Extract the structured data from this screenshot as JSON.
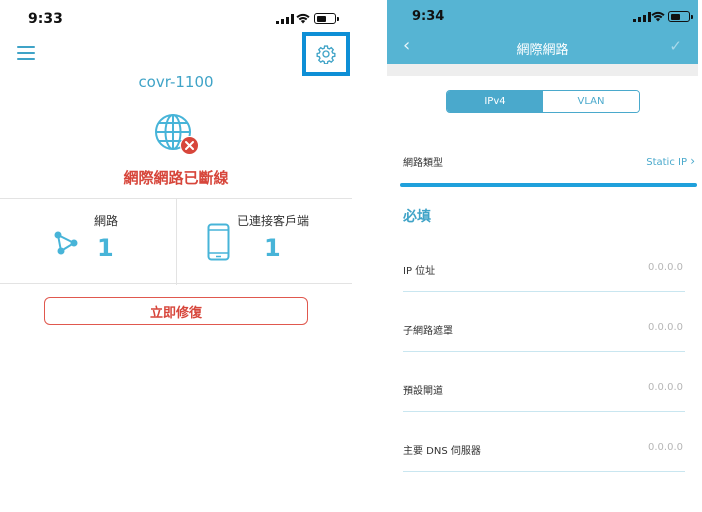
{
  "left": {
    "status_bar": {
      "time": "9:33"
    },
    "device_name": "covr-1100",
    "internet_status": "網際網路已斷線",
    "stats": {
      "network": {
        "label": "網路",
        "value": "1"
      },
      "clients": {
        "label": "已連接客戶端",
        "value": "1"
      }
    },
    "repair_button": "立即修復",
    "colors": {
      "accent": "#47b4d8",
      "error": "#d7463b",
      "highlight_box": "#0e8fd6"
    }
  },
  "right": {
    "status_bar": {
      "time": "9:34"
    },
    "header": {
      "title": "網際網路"
    },
    "tabs": [
      {
        "label": "IPv4",
        "active": true
      },
      {
        "label": "VLAN",
        "active": false
      }
    ],
    "connection_type": {
      "label": "網路類型",
      "value": "Static IP"
    },
    "section_title": "必填",
    "fields": [
      {
        "label": "IP 位址",
        "placeholder": "0.0.0.0"
      },
      {
        "label": "子網路遮罩",
        "placeholder": "0.0.0.0"
      },
      {
        "label": "預設閘道",
        "placeholder": "0.0.0.0"
      },
      {
        "label": "主要 DNS 伺服器",
        "placeholder": "0.0.0.0"
      }
    ],
    "colors": {
      "header": "#56b4d3",
      "accent": "#4aa9cc"
    }
  }
}
